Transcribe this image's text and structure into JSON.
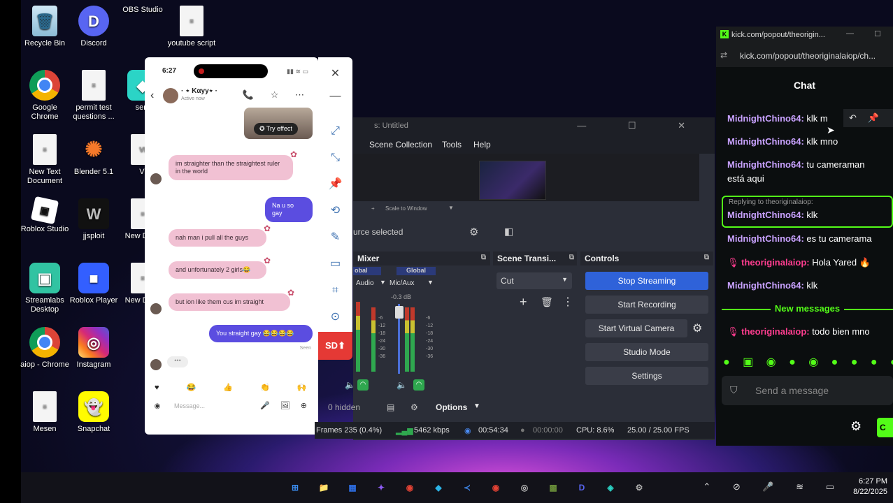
{
  "desktop": {
    "icons": [
      {
        "label": "Recycle Bin",
        "glyph": "🗑"
      },
      {
        "label": "Discord",
        "glyph": "D"
      },
      {
        "label": "OBS Studio",
        "glyph": "◎"
      },
      {
        "label": "youtube script",
        "glyph": "≡"
      },
      {
        "label": "Google Chrome",
        "glyph": ""
      },
      {
        "label": "permit test questions ...",
        "glyph": "≡"
      },
      {
        "label": "serv",
        "glyph": "◆"
      },
      {
        "label": "New Text Document",
        "glyph": "≡"
      },
      {
        "label": "Blender 5.1",
        "glyph": "✺"
      },
      {
        "label": "Vi",
        "glyph": "VI"
      },
      {
        "label": "Roblox Studio",
        "glyph": "▣"
      },
      {
        "label": "jjsploit",
        "glyph": "W"
      },
      {
        "label": "New Docu",
        "glyph": "≡"
      },
      {
        "label": "Streamlabs Desktop",
        "glyph": "▣"
      },
      {
        "label": "Roblox Player",
        "glyph": "■"
      },
      {
        "label": "New Docu",
        "glyph": "≡"
      },
      {
        "label": "aiop - Chrome",
        "glyph": ""
      },
      {
        "label": "Instagram",
        "glyph": "◎"
      },
      {
        "label": "Mesen",
        "glyph": "≡"
      },
      {
        "label": "Snapchat",
        "glyph": "👻"
      }
    ]
  },
  "phone": {
    "time": "6:27",
    "signal": "▮▮ ≋ ▭",
    "contact_name": "· ⋆ Kαyy⋆ ·",
    "active_status": "Active now",
    "back_glyph": "‹",
    "actions": "📞 ☆ ⋯",
    "try_effect_label": "✪ Try effect",
    "messages": [
      {
        "dir": "in",
        "text": "im straighter than the straightest ruler in the world"
      },
      {
        "dir": "out",
        "text": "Na u so gay"
      },
      {
        "dir": "in",
        "text": "nah man i pull all the guys"
      },
      {
        "dir": "in",
        "text": "and unfortunately 2 girls😂"
      },
      {
        "dir": "in",
        "text": "but ion like them cus im straight"
      },
      {
        "dir": "out",
        "text": "You straight gay 😂😂😂😂"
      }
    ],
    "seen": "Seen",
    "typing": "•••",
    "reactions": "♥ 😂 👍 👏 🙌 🌹 ✨",
    "camera_glyph": "◉",
    "message_placeholder": "Message...",
    "composer_icons": "🎤 🖼 ⊕"
  },
  "phone_toolbar": {
    "close": "✕",
    "minimize": "—",
    "tools": [
      "⤢",
      "⤡",
      "📌",
      "⟲",
      "✎",
      "▭",
      "⌗",
      "⊙"
    ],
    "sd_label": "SD⬆"
  },
  "obs": {
    "title": "s: Untitled",
    "window_buttons": "— ☐ ✕",
    "menu": [
      "Scene Collection",
      "Tools",
      "Help"
    ],
    "scale_label": "Scale to Window",
    "no_source": "urce selected",
    "docks": {
      "mixer": "Mixer",
      "transitions": "Scene Transi...",
      "controls": "Controls"
    },
    "mixer": {
      "channels": [
        {
          "tag": "obal",
          "name": "Audio",
          "level": ""
        },
        {
          "tag": "Global",
          "name": "Mic/Aux",
          "level": "-0.3 dB"
        }
      ],
      "hidden": "0 hidden",
      "options": "Options"
    },
    "transition": "Cut",
    "controls": [
      {
        "label": "Stop Streaming",
        "active": true
      },
      {
        "label": "Start Recording",
        "active": false
      },
      {
        "label": "Start Virtual Camera",
        "active": false
      },
      {
        "label": "Studio Mode",
        "active": false
      },
      {
        "label": "Settings",
        "active": false
      }
    ],
    "status": {
      "frames": "Frames 235 (0.4%)",
      "bitrate": "5462 kbps",
      "stream_time": "00:54:34",
      "rec_time": "00:00:00",
      "cpu": "CPU: 8.6%",
      "fps": "25.00 / 25.00 FPS"
    }
  },
  "kick": {
    "tab_title": "kick.com/popout/theorigin...",
    "url": "kick.com/popout/theoriginalaiop/ch...",
    "heading": "Chat",
    "reply_to": "Replying to theoriginalaiop:",
    "new_messages": "New messages",
    "send_placeholder": "Send a message",
    "send_label": "C",
    "emotes": "● ▣ ◉ ● ◉ ● ● ● ●",
    "messages": [
      {
        "user": "MidnightChino64",
        "text": " klk m",
        "role": "viewer"
      },
      {
        "user": "MidnightChino64",
        "text": " klk mno",
        "role": "viewer"
      },
      {
        "user": "MidnightChino64",
        "text": " tu cameraman",
        "text2": "está aqui",
        "role": "viewer"
      },
      {
        "user": "MidnightChino64",
        "text": " klk",
        "role": "viewer"
      },
      {
        "user": "MidnightChino64",
        "text": " es tu camerama",
        "role": "viewer"
      },
      {
        "user": "theoriginalaiop",
        "text": " Hola Yared 🔥",
        "role": "host"
      },
      {
        "user": "MidnightChino64",
        "text": " klk",
        "role": "viewer"
      },
      {
        "user": "theoriginalaiop",
        "text": " todo bien mno",
        "role": "host"
      }
    ]
  },
  "taskbar": {
    "apps": [
      "⊞",
      "📁",
      "▦",
      "✦",
      "◉",
      "◆",
      "≺",
      "◉",
      "◎",
      "▩",
      "D",
      "◈",
      "⚙"
    ],
    "tray": "⌃ ⊘ 🎤 ≋ ▭",
    "time": "6:27 PM",
    "date": "8/22/2025"
  }
}
